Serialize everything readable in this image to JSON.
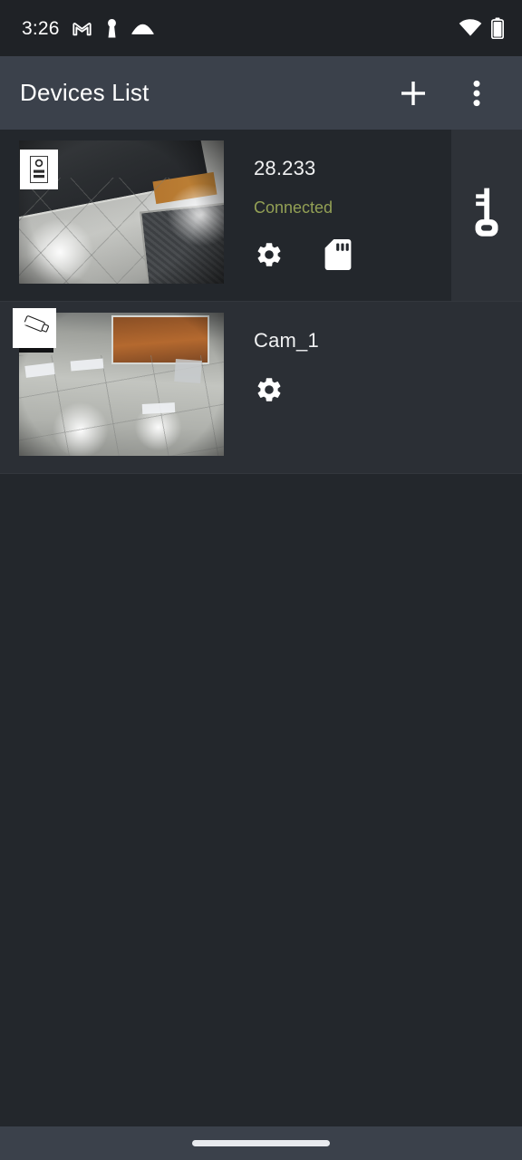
{
  "status_bar": {
    "clock": "3:26",
    "icons": [
      "gmail-icon",
      "keyhole-icon",
      "cloud-icon"
    ],
    "right_icons": [
      "wifi-icon",
      "battery-icon"
    ],
    "background": "#1f2226"
  },
  "app_bar": {
    "title": "Devices List",
    "add_label": "+",
    "overflow_label": "⋮",
    "background": "#3b414b"
  },
  "colors": {
    "page_background": "#23272c",
    "row_background": "#23272c",
    "row_alt_background": "#2b2f35",
    "side_panel": "#2e3238",
    "divider": "#33373d",
    "connected_text": "#93a055",
    "primary_text": "#f0f1f2"
  },
  "devices": [
    {
      "name": "28.233",
      "status": "Connected",
      "type_icon": "doorbell-icon",
      "actions": [
        "settings-icon",
        "sd-card-icon"
      ],
      "side_action": "key-icon",
      "has_side_panel": true
    },
    {
      "name": "Cam_1",
      "status": "",
      "type_icon": "cctv-camera-icon",
      "actions": [
        "settings-icon"
      ],
      "side_action": "",
      "has_side_panel": false
    }
  ],
  "nav_bar": {
    "gesture_handle": "home-indicator"
  }
}
